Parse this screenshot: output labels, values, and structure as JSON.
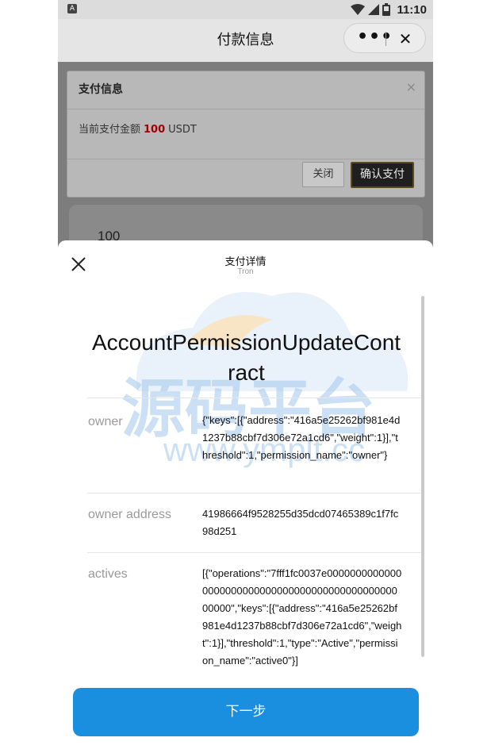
{
  "status_bar": {
    "app_badge": "A",
    "time": "11:10"
  },
  "header": {
    "title": "付款信息",
    "more_label": "•••",
    "close_label": "✕"
  },
  "pay_info_dialog": {
    "title": "支付信息",
    "close_symbol": "×",
    "amount_prefix": "当前支付金额",
    "amount": "100",
    "currency": "USDT",
    "close_button": "关闭",
    "confirm_button": "确认支付"
  },
  "behind_amount": "100",
  "sheet": {
    "title": "支付详情",
    "subtitle": "Tron",
    "contract_name": "AccountPermissionUpdateContract",
    "fields": [
      {
        "label": "owner",
        "value": "{\"keys\":[{\"address\":\"416a5e25262bf981e4d1237b88cbf7d306e72a1cd6\",\"weight\":1}],\"threshold\":1,\"permission_name\":\"owner\"}"
      },
      {
        "label": "owner address",
        "value": "41986664f9528255d35dcd07465389c1f7fc98d251"
      },
      {
        "label": "actives",
        "value": "[{\"operations\":\"7fff1fc0037e0000000000000000000000000000000000000000000000000000\",\"keys\":[{\"address\":\"416a5e25262bf981e4d1237b88cbf7d306e72a1cd6\",\"weight\":1}],\"threshold\":1,\"type\":\"Active\",\"permission_name\":\"active0\"}]"
      }
    ],
    "next_button": "下一步"
  },
  "watermark": {
    "text_cn": "源码平台",
    "text_url": "www.ymplt.cc"
  },
  "colors": {
    "primary": "#1a8fe0",
    "amount_red": "#a00000"
  }
}
